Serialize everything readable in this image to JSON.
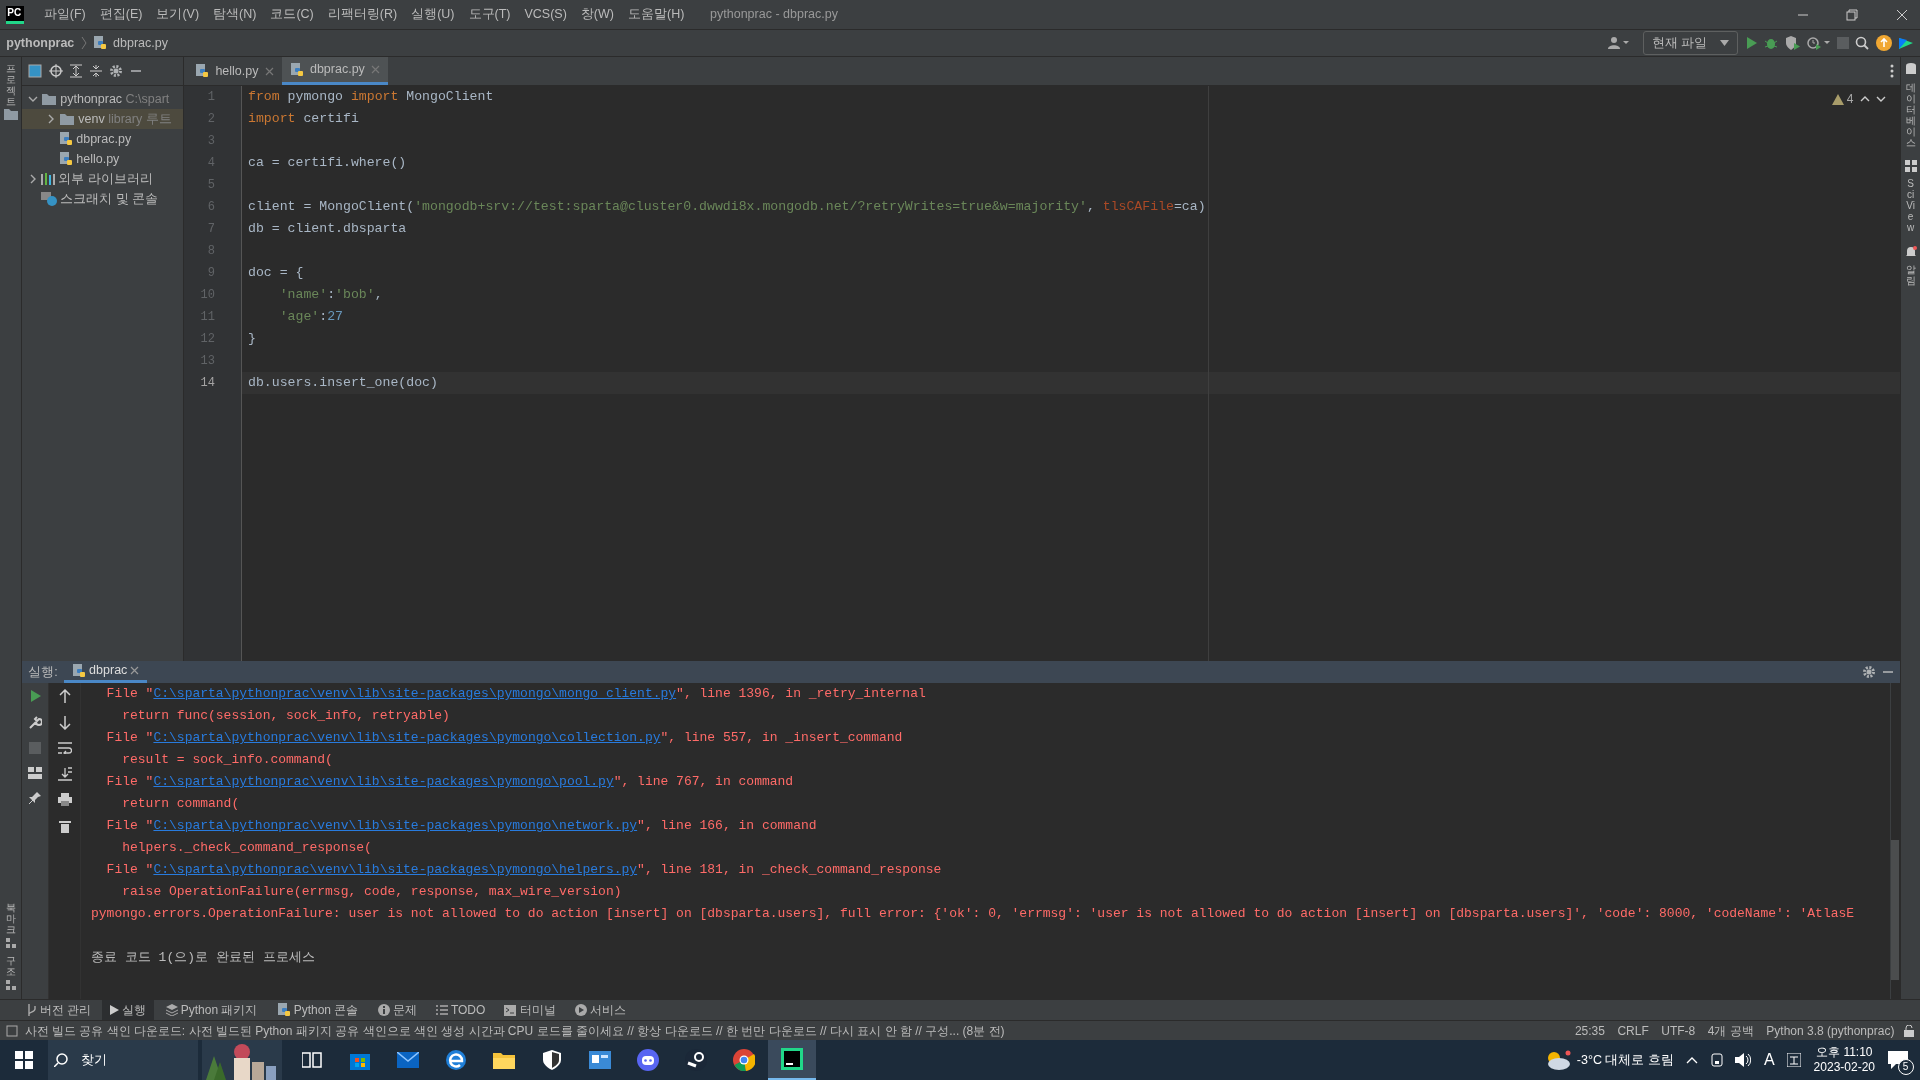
{
  "app": {
    "logo": "PC",
    "menu": [
      "파일(F)",
      "편집(E)",
      "보기(V)",
      "탐색(N)",
      "코드(C)",
      "리팩터링(R)",
      "실행(U)",
      "도구(T)",
      "VCS(S)",
      "창(W)",
      "도움말(H)"
    ],
    "title": "pythonprac - dbprac.py"
  },
  "breadcrumb": [
    "pythonprac",
    "dbprac.py"
  ],
  "toolbar": {
    "run_config": "현재 파일"
  },
  "left_strip": {
    "top": [
      "프로젝트"
    ],
    "bottom": [
      "북마크",
      "구조"
    ]
  },
  "right_strip": [
    "데이터베이스",
    "SciView",
    "알림"
  ],
  "project_tree": [
    {
      "label": "pythonprac",
      "hint": "C:\\spart",
      "kind": "folder",
      "expanded": true,
      "selected": false,
      "children": [
        {
          "label": "venv",
          "hint": "library 루트",
          "kind": "folder",
          "expanded": false,
          "selected": true
        },
        {
          "label": "dbprac.py",
          "kind": "python",
          "selected": false
        },
        {
          "label": "hello.py",
          "kind": "python",
          "selected": false
        }
      ]
    },
    {
      "label": "외부 라이브러리",
      "kind": "library",
      "expanded": false,
      "selected": false
    },
    {
      "label": "스크래치 및 콘솔",
      "kind": "scratch",
      "selected": false
    }
  ],
  "editor_tabs": [
    {
      "label": "hello.py",
      "selected": false
    },
    {
      "label": "dbprac.py",
      "selected": true
    }
  ],
  "editor": {
    "warnings": "4",
    "lines": [
      {
        "number": "1",
        "current": false,
        "tokens": [
          {
            "kind": "kw",
            "t": "from"
          },
          {
            "kind": "plain",
            "t": " pymongo "
          },
          {
            "kind": "kw",
            "t": "import"
          },
          {
            "kind": "plain",
            "t": " MongoClient"
          }
        ]
      },
      {
        "number": "2",
        "current": false,
        "tokens": [
          {
            "kind": "kw",
            "t": "import"
          },
          {
            "kind": "plain",
            "t": " certifi"
          }
        ]
      },
      {
        "number": "3",
        "current": false
      },
      {
        "number": "4",
        "current": false,
        "tokens": [
          {
            "kind": "plain",
            "t": "ca = certifi.where()"
          }
        ]
      },
      {
        "number": "5",
        "current": false
      },
      {
        "number": "6",
        "current": false,
        "tokens": [
          {
            "kind": "plain",
            "t": "client = MongoClient("
          },
          {
            "kind": "str",
            "t": "'mongodb+srv://test:sparta@cluster0.dwwdi8x.mongodb.net/?retryWrites=true&w=majority'"
          },
          {
            "kind": "plain",
            "t": ", "
          },
          {
            "kind": "param",
            "t": "tlsCAFile"
          },
          {
            "kind": "plain",
            "t": "=ca)"
          }
        ]
      },
      {
        "number": "7",
        "current": false,
        "tokens": [
          {
            "kind": "plain",
            "t": "db = client.dbsparta"
          }
        ]
      },
      {
        "number": "8",
        "current": false
      },
      {
        "number": "9",
        "current": false,
        "tokens": [
          {
            "kind": "plain",
            "t": "doc = {"
          }
        ]
      },
      {
        "number": "10",
        "current": false,
        "tokens": [
          {
            "kind": "str",
            "t": "    'name'"
          },
          {
            "kind": "plain",
            "t": ":"
          },
          {
            "kind": "str",
            "t": "'bob'"
          },
          {
            "kind": "plain",
            "t": ","
          }
        ]
      },
      {
        "number": "11",
        "current": false,
        "tokens": [
          {
            "kind": "str",
            "t": "    'age'"
          },
          {
            "kind": "plain",
            "t": ":"
          },
          {
            "kind": "num",
            "t": "27"
          }
        ]
      },
      {
        "number": "12",
        "current": false,
        "tokens": [
          {
            "kind": "plain",
            "t": "}"
          }
        ]
      },
      {
        "number": "13",
        "current": false
      },
      {
        "number": "14",
        "current": true,
        "tokens": [
          {
            "kind": "plain",
            "t": "db.users.insert_one(doc)"
          }
        ]
      }
    ]
  },
  "run_panel": {
    "label": "실행:",
    "tab": "dbprac",
    "lines": [
      {
        "kind": "file",
        "before": "  File \"",
        "link": "C:\\sparta\\pythonprac\\venv\\lib\\site-packages\\pymongo\\mongo_client.py",
        "after": "\", line 1396, in _retry_internal"
      },
      {
        "kind": "trace",
        "text": "    return func(session, sock_info, retryable)"
      },
      {
        "kind": "file",
        "before": "  File \"",
        "link": "C:\\sparta\\pythonprac\\venv\\lib\\site-packages\\pymongo\\collection.py",
        "after": "\", line 557, in _insert_command"
      },
      {
        "kind": "trace",
        "text": "    result = sock_info.command("
      },
      {
        "kind": "file",
        "before": "  File \"",
        "link": "C:\\sparta\\pythonprac\\venv\\lib\\site-packages\\pymongo\\pool.py",
        "after": "\", line 767, in command"
      },
      {
        "kind": "trace",
        "text": "    return command("
      },
      {
        "kind": "file",
        "before": "  File \"",
        "link": "C:\\sparta\\pythonprac\\venv\\lib\\site-packages\\pymongo\\network.py",
        "after": "\", line 166, in command"
      },
      {
        "kind": "trace",
        "text": "    helpers._check_command_response("
      },
      {
        "kind": "file",
        "before": "  File \"",
        "link": "C:\\sparta\\pythonprac\\venv\\lib\\site-packages\\pymongo\\helpers.py",
        "after": "\", line 181, in _check_command_response"
      },
      {
        "kind": "trace",
        "text": "    raise OperationFailure(errmsg, code, response, max_wire_version)"
      },
      {
        "kind": "trace",
        "text": "pymongo.errors.OperationFailure: user is not allowed to do action [insert] on [dbsparta.users], full error: {'ok': 0, 'errmsg': 'user is not allowed to do action [insert] on [dbsparta.users]', 'code': 8000, 'codeName': 'AtlasE"
      },
      {
        "kind": "info",
        "text": "종료 코드 1(으)로 완료된 프로세스"
      }
    ]
  },
  "tool_tabs": [
    {
      "label": "버전 관리",
      "selected": false
    },
    {
      "label": "실행",
      "selected": true
    },
    {
      "label": "Python 패키지",
      "selected": false
    },
    {
      "label": "Python 콘솔",
      "selected": false
    },
    {
      "label": "문제",
      "selected": false
    },
    {
      "label": "TODO",
      "selected": false
    },
    {
      "label": "터미널",
      "selected": false
    },
    {
      "label": "서비스",
      "selected": false
    }
  ],
  "status_bar": {
    "message": "사전 빌드 공유 색인 다운로드: 사전 빌드된 Python 패키지 공유 색인으로 색인 생성 시간과 CPU 로드를 줄이세요 // 항상 다운로드 // 한 번만 다운로드 // 다시 표시 안 함 // 구성... (8분 전)",
    "items": [
      "25:35",
      "CRLF",
      "UTF-8",
      "4개 공백",
      "Python 3.8 (pythonprac)"
    ]
  },
  "taskbar": {
    "search": "찾기",
    "apps": [
      {
        "kind": "taskview",
        "selected": false
      },
      {
        "kind": "store",
        "selected": false
      },
      {
        "kind": "mail",
        "selected": false
      },
      {
        "kind": "edge",
        "selected": false
      },
      {
        "kind": "explorer",
        "selected": false
      },
      {
        "kind": "shield",
        "selected": false
      },
      {
        "kind": "window",
        "selected": false
      },
      {
        "kind": "discord",
        "selected": false
      },
      {
        "kind": "steam",
        "selected": false
      },
      {
        "kind": "chrome",
        "selected": false
      },
      {
        "kind": "pycharm",
        "selected": true
      }
    ],
    "weather": "-3°C 대체로 흐림",
    "ime": "A",
    "time": "오후 11:10",
    "date": "2023-02-20",
    "notifications": "5"
  }
}
